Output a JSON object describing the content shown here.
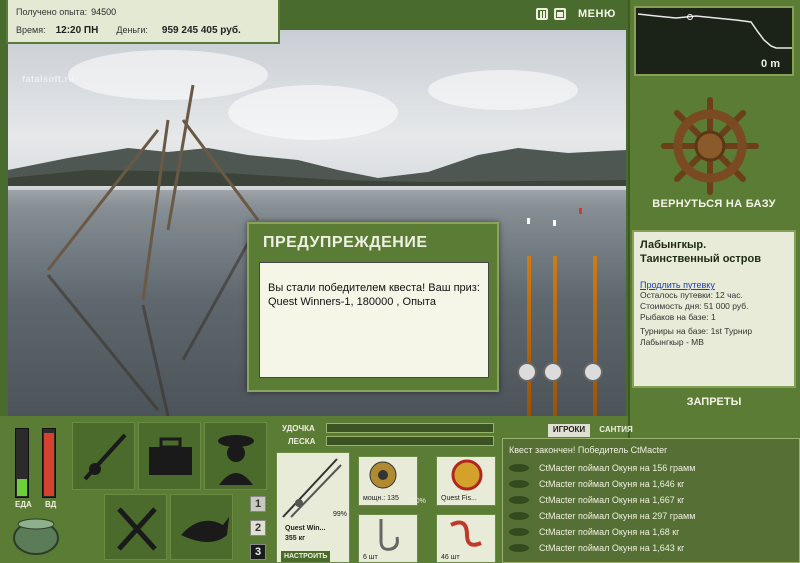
{
  "info": {
    "exp_label": "Получено опыта:",
    "exp_value": "94500",
    "time_label": "Время:",
    "time_value": "12:20 ПН",
    "money_label": "Деньги:",
    "money_value": "959 245 405 руб."
  },
  "watermark": "fatalsoft.ru",
  "top": {
    "menu_label": "МЕНЮ"
  },
  "depth": {
    "value": "0 m"
  },
  "right": {
    "return_label": "ВЕРНУТЬСЯ НА БАЗУ",
    "base_title": "Лабынгкыр. Таинственный остров",
    "extend_link": "Продлить путевку",
    "lines": [
      "Осталось путевки: 12 час.",
      "Стоимость дня: 51 000 руб.",
      "Рыбаков на базе: 1",
      "Турниры на базе: 1st Турнир Лабынгкыр - МВ"
    ],
    "bans_label": "ЗАПРЕТЫ"
  },
  "dialog": {
    "title": "ПРЕДУПРЕЖДЕНИЕ",
    "text": "Вы стали победителем квеста! Ваш приз: Quest Winners-1, 180000 , Опыта"
  },
  "gauges": {
    "food_label": "ЕДА",
    "health_label": "ВД",
    "food_level": 0.25,
    "health_level": 0.92,
    "food_color": "#6fcf3a",
    "health_color": "#d3422c"
  },
  "numbers": [
    "1",
    "2",
    "3"
  ],
  "tackle": {
    "rod_label": "УДОЧКА",
    "line_label": "ЛЕСКА",
    "rod_name": "Quest Win...",
    "rod_weight": "355 кг",
    "rod_percent": "99%",
    "reel_caption": "мощн.: 135",
    "reel_percent": "100%",
    "line_caption": "Quest Fis...",
    "hook_caption": "6 шт",
    "bait_caption": "46 шт",
    "setup_label": "НАСТРОИТЬ"
  },
  "chat": {
    "tab_players": "ИГРОКИ",
    "tab_catch": "САНТИЯ",
    "header": "Квест закончен! Победитель CtMacter",
    "messages": [
      "CtMacter поймал Окуня на 156 грамм",
      "CtMacter поймал Окуня на 1,646 кг",
      "CtMacter поймал Окуня на 1,667 кг",
      "CtMacter поймал Окуня на 297 грамм",
      "CtMacter поймал Окуня на 1,68 кг",
      "CtMacter поймал Окуня на 1,643 кг"
    ]
  },
  "colors": {
    "panel_green": "#5a7c34",
    "panel_light": "#e7ebd7",
    "link_blue": "#1740b8",
    "rod_orange": "#d07b12"
  }
}
